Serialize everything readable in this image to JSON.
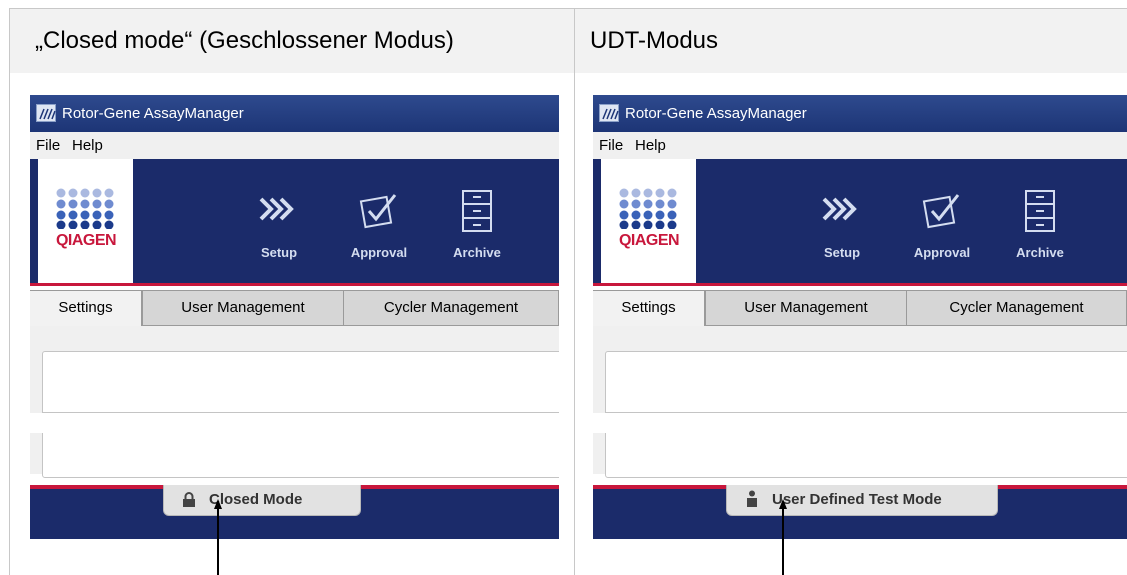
{
  "headers": {
    "left": "„Closed mode“ (Geschlossener Modus)",
    "right": "UDT-Modus"
  },
  "app": {
    "title": "Rotor-Gene AssayManager",
    "menu": [
      "File",
      "Help"
    ],
    "logo_text": "QIAGEN",
    "nav": [
      "Setup",
      "Approval",
      "Archive"
    ],
    "tabs": [
      "Settings",
      "User Management",
      "Cycler Management"
    ]
  },
  "modes": {
    "left": "Closed Mode",
    "right": "User Defined Test Mode"
  },
  "colors": {
    "banner": "#1b2b6a",
    "accent_red": "#c8173c",
    "titlebar": "#2e4a8e",
    "logo_dots": "#3a62b8"
  },
  "icons": {
    "setup": "chevrons-icon",
    "approval": "checkbox-icon",
    "archive": "cabinet-icon",
    "closed_mode": "lock-icon",
    "udt_mode": "person-icon"
  }
}
